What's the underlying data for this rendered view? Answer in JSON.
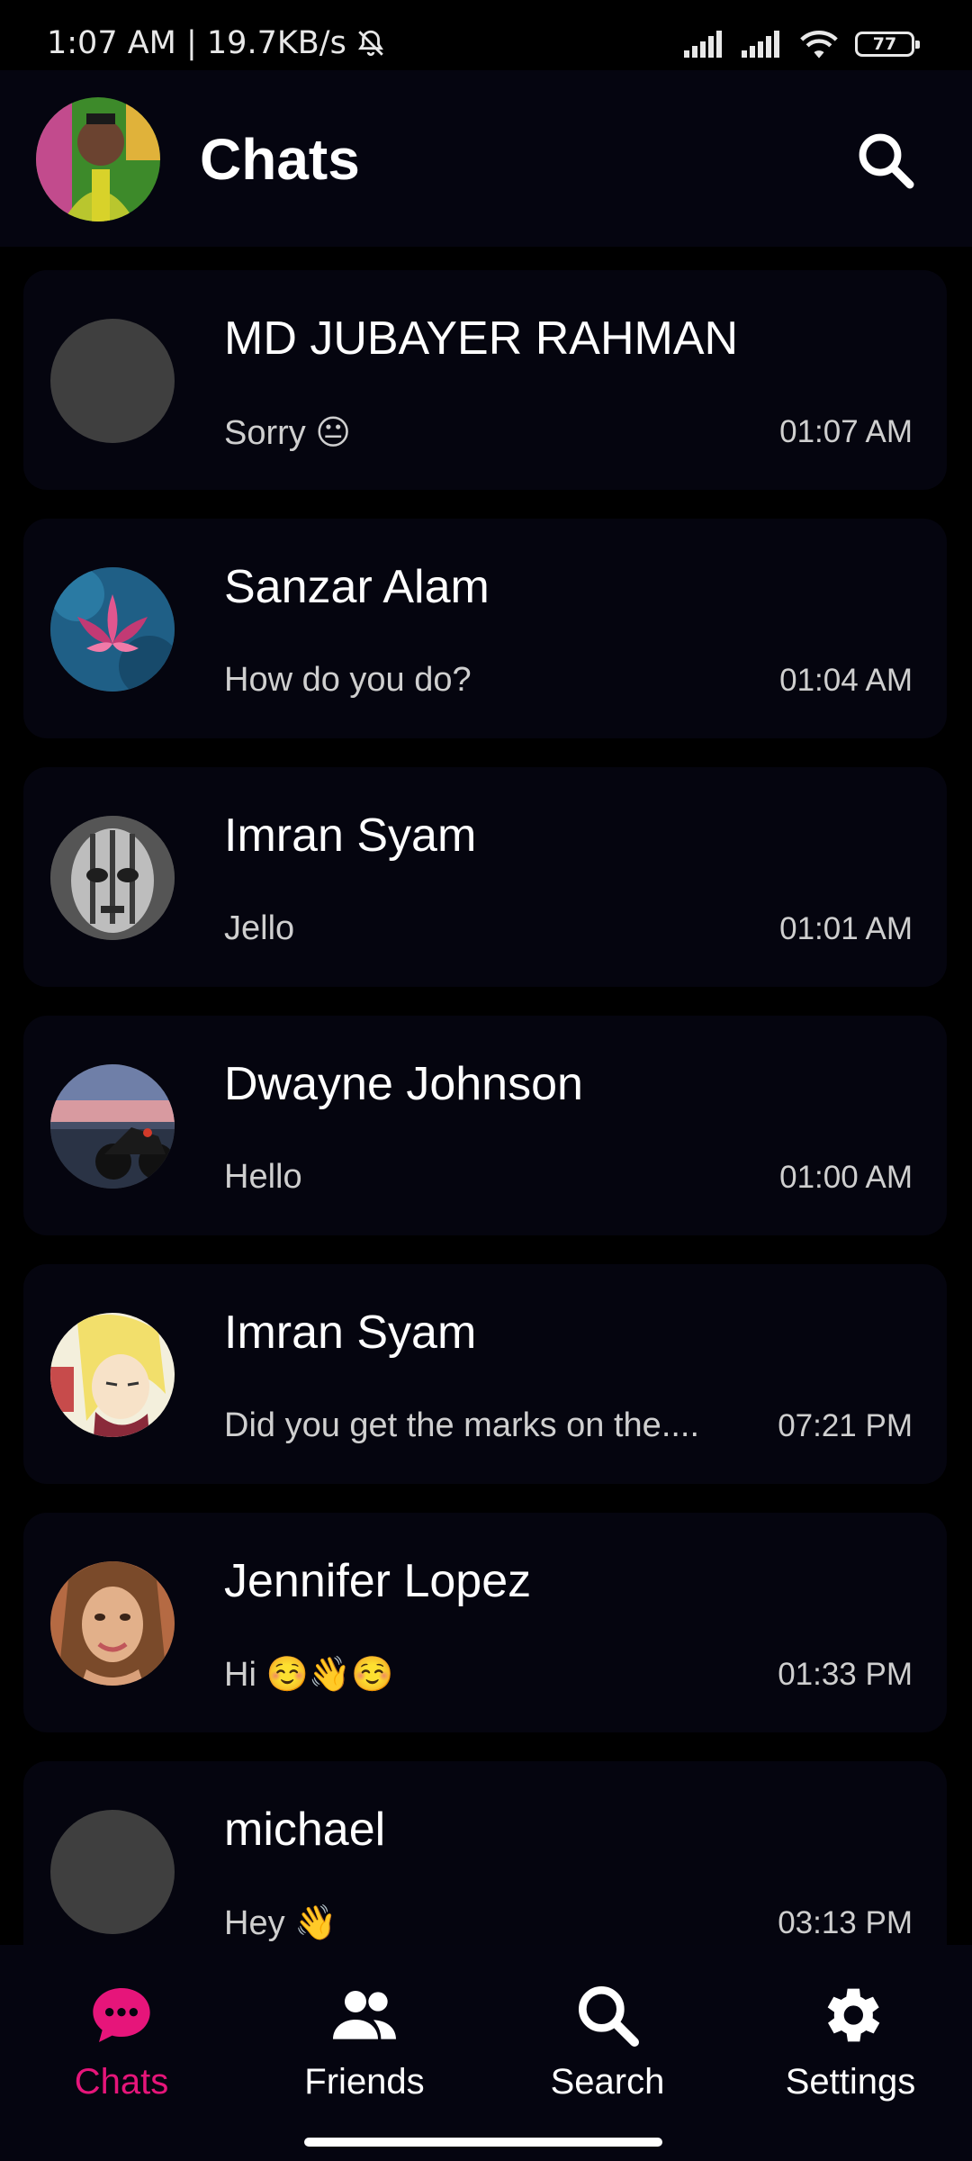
{
  "status_bar": {
    "time_speed": "1:07 AM | 19.7KB/s",
    "battery": "77",
    "icons": [
      "muted-bell-icon",
      "signal-icon",
      "signal-icon",
      "wifi-icon",
      "battery-icon"
    ]
  },
  "header": {
    "title": "Chats",
    "search_icon": "search-icon"
  },
  "chats": [
    {
      "name": "MD JUBAYER RAHMAN",
      "message": "Sorry 😐",
      "time": "01:07 AM",
      "avatar": "placeholder"
    },
    {
      "name": "Sanzar Alam",
      "message": "How do you do?",
      "time": "01:04 AM",
      "avatar": "lotus"
    },
    {
      "name": "Imran Syam",
      "message": "Jello",
      "time": "01:01 AM",
      "avatar": "face-grey"
    },
    {
      "name": "Dwayne Johnson",
      "message": "Hello",
      "time": "01:00 AM",
      "avatar": "motorcycle"
    },
    {
      "name": "Imran Syam",
      "message": "Did you get the marks on the....",
      "time": "07:21 PM",
      "avatar": "anime"
    },
    {
      "name": "Jennifer Lopez",
      "message": "Hi ☺️👋☺️",
      "time": "01:33 PM",
      "avatar": "portrait"
    },
    {
      "name": "michael",
      "message": "Hey 👋",
      "time": "03:13 PM",
      "avatar": "placeholder"
    }
  ],
  "nav": {
    "chats": "Chats",
    "friends": "Friends",
    "search": "Search",
    "settings": "Settings"
  },
  "colors": {
    "accent": "#e6157a",
    "background": "#000000",
    "card": "#05050f",
    "text_secondary": "#cfcfcf"
  }
}
